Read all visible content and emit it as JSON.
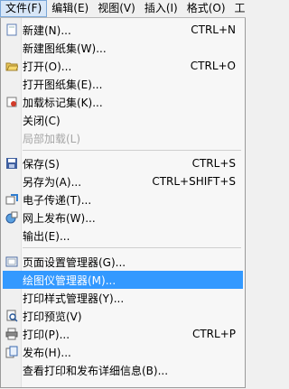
{
  "menubar": {
    "items": [
      "文件(F)",
      "编辑(E)",
      "视图(V)",
      "插入(I)",
      "格式(O)",
      "工"
    ]
  },
  "menu": {
    "items": [
      {
        "label": "新建(N)...",
        "shortcut": "CTRL+N",
        "icon": "new-document-icon"
      },
      {
        "label": "新建图纸集(W)...",
        "shortcut": "",
        "icon": ""
      },
      {
        "label": "打开(O)...",
        "shortcut": "CTRL+O",
        "icon": "open-folder-icon"
      },
      {
        "label": "打开图纸集(E)...",
        "shortcut": "",
        "icon": ""
      },
      {
        "label": "加载标记集(K)...",
        "shortcut": "",
        "icon": "markup-set-icon"
      },
      {
        "label": "关闭(C)",
        "shortcut": "",
        "icon": ""
      },
      {
        "label": "局部加载(L)",
        "shortcut": "",
        "icon": "",
        "disabled": true
      },
      {
        "label": "保存(S)",
        "shortcut": "CTRL+S",
        "icon": "save-disk-icon"
      },
      {
        "label": "另存为(A)...",
        "shortcut": "CTRL+SHIFT+S",
        "icon": ""
      },
      {
        "label": "电子传递(T)...",
        "shortcut": "",
        "icon": "etransmit-icon"
      },
      {
        "label": "网上发布(W)...",
        "shortcut": "",
        "icon": "publish-web-icon"
      },
      {
        "label": "输出(E)...",
        "shortcut": "",
        "icon": ""
      },
      {
        "label": "页面设置管理器(G)...",
        "shortcut": "",
        "icon": "page-setup-icon"
      },
      {
        "label": "绘图仪管理器(M)...",
        "shortcut": "",
        "icon": "",
        "highlight": true
      },
      {
        "label": "打印样式管理器(Y)...",
        "shortcut": "",
        "icon": ""
      },
      {
        "label": "打印预览(V)",
        "shortcut": "",
        "icon": "print-preview-icon"
      },
      {
        "label": "打印(P)...",
        "shortcut": "CTRL+P",
        "icon": "printer-icon"
      },
      {
        "label": "发布(H)...",
        "shortcut": "",
        "icon": "publish-icon"
      },
      {
        "label": "查看打印和发布详细信息(B)...",
        "shortcut": "",
        "icon": ""
      }
    ]
  }
}
